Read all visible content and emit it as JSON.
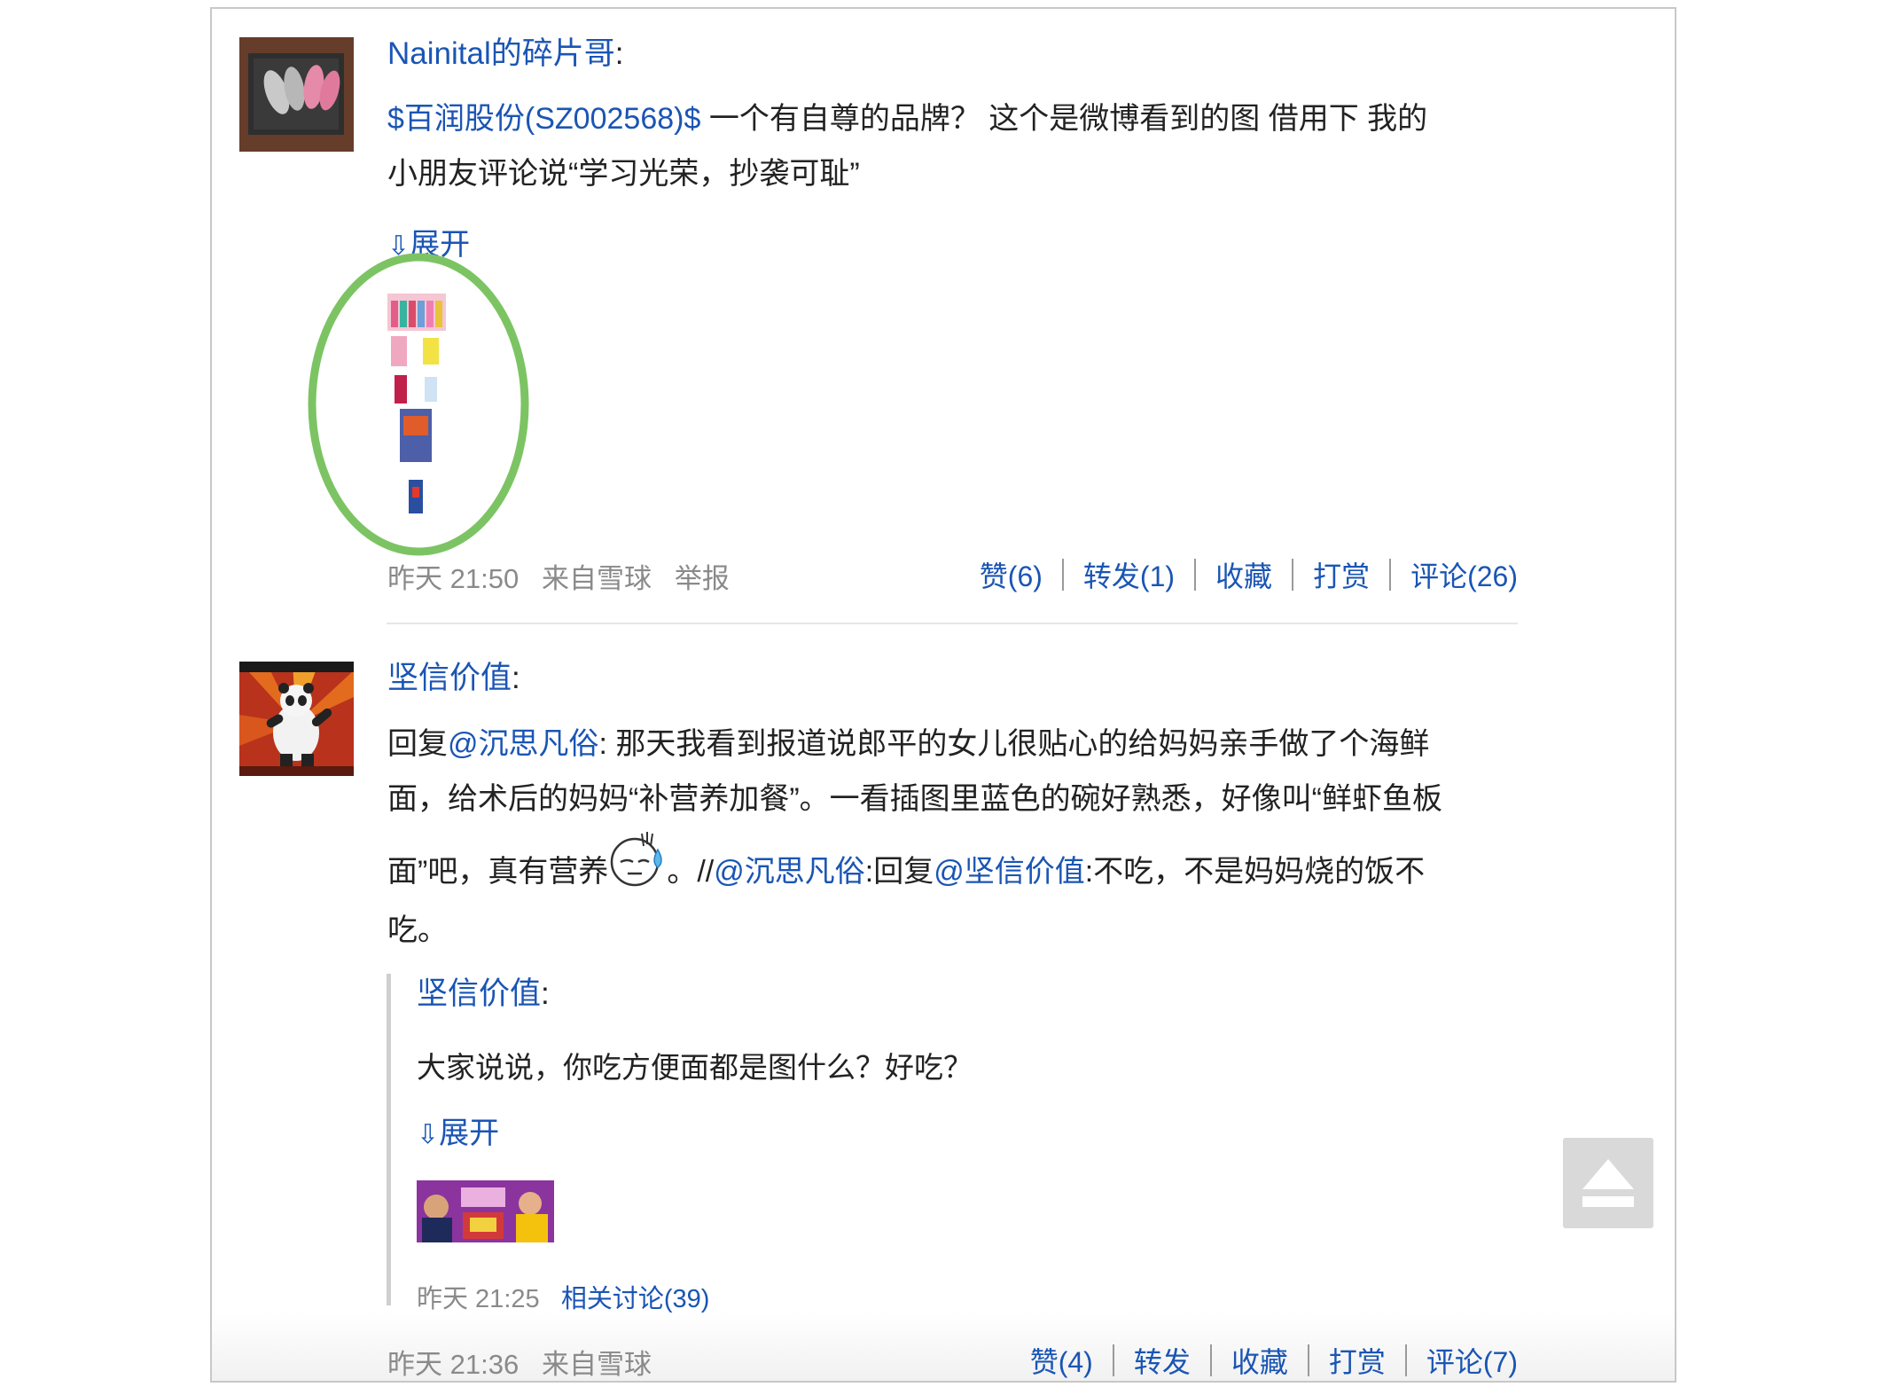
{
  "post1": {
    "author": "Nainital的碎片哥",
    "stock_link": "$百润股份(SZ002568)$",
    "text_line1": " 一个有自尊的品牌？ 这个是微博看到的图 借用下 我的",
    "text_line2": "小朋友评论说“学习光荣，抄袭可耻”",
    "expand_label": "展开",
    "time": "昨天 21:50",
    "source": "来自雪球",
    "report": "举报",
    "actions": {
      "like": "赞(6)",
      "repost": "转发(1)",
      "favorite": "收藏",
      "tip": "打赏",
      "comment": "评论(26)"
    }
  },
  "post2": {
    "author": "坚信价值",
    "reply_prefix": "回复",
    "mention1": "@沉思凡俗",
    "text_line1_rest": ": 那天我看到报道说郎平的女儿很贴心的给妈妈亲手做了个海鲜",
    "text_line2": "面，给术后的妈妈“补营养加餐”。一看插图里蓝色的碗好熟悉，好像叫“鲜虾鱼板",
    "text_line3_a": "面”吧，真有营养",
    "text_line3_b": "。//",
    "mention2": "@沉思凡俗",
    "text_line3_c": ":回复",
    "mention3": "@坚信价值",
    "text_line3_d": ":不吃，不是妈妈烧的饭不",
    "text_line4": "吃。",
    "emoji_icon": "sweat-emoji-icon",
    "quoted": {
      "author": "坚信价值",
      "text": "大家说说，你吃方便面都是图什么？好吃？",
      "expand_label": "展开",
      "time": "昨天 21:25",
      "related": "相关讨论(39)"
    },
    "time": "昨天 21:36",
    "source": "来自雪球",
    "actions": {
      "like": "赞(4)",
      "repost": "转发",
      "favorite": "收藏",
      "tip": "打赏",
      "comment": "评论(7)"
    }
  },
  "colors": {
    "link": "#1a55b4",
    "highlight_circle": "#7cc463",
    "meta_gray": "#8a8a8a"
  }
}
